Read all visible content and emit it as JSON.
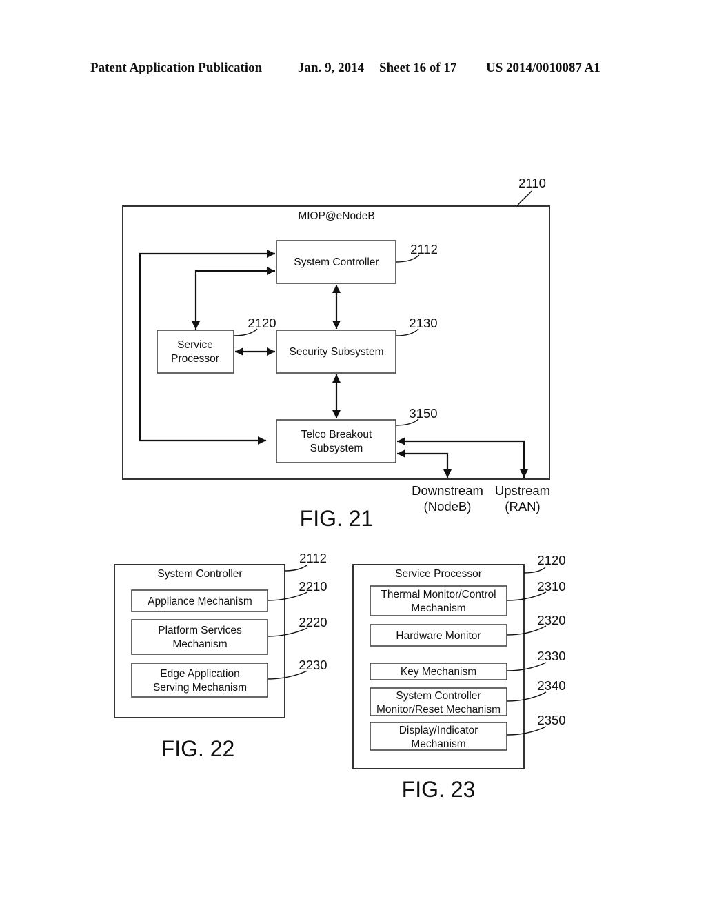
{
  "header": {
    "publication": "Patent Application Publication",
    "date": "Jan. 9, 2014",
    "sheet": "Sheet 16 of 17",
    "number": "US 2014/0010087 A1"
  },
  "fig21": {
    "caption": "FIG. 21",
    "container": {
      "title": "MIOP@eNodeB",
      "ref": "2110"
    },
    "blocks": {
      "system_controller": {
        "lines": [
          "System Controller"
        ],
        "ref": "2112"
      },
      "service_processor": {
        "lines": [
          "Service",
          "Processor"
        ],
        "ref": "2120"
      },
      "security_subsystem": {
        "lines": [
          "Security Subsystem"
        ],
        "ref": "2130"
      },
      "telco_breakout": {
        "lines": [
          "Telco Breakout",
          "Subsystem"
        ],
        "ref": "3150"
      }
    },
    "external": {
      "downstream": [
        "Downstream",
        "(NodeB)"
      ],
      "upstream": [
        "Upstream",
        "(RAN)"
      ]
    },
    "connections": [
      {
        "from": "telco_breakout",
        "to": "system_controller",
        "direction": "to"
      },
      {
        "from": "system_controller",
        "to": "service_processor",
        "direction": "both"
      },
      {
        "from": "system_controller",
        "to": "security_subsystem",
        "direction": "both"
      },
      {
        "from": "service_processor",
        "to": "security_subsystem",
        "direction": "both"
      },
      {
        "from": "security_subsystem",
        "to": "telco_breakout",
        "direction": "both"
      },
      {
        "from": "telco_breakout",
        "to": "downstream",
        "direction": "both"
      },
      {
        "from": "telco_breakout",
        "to": "upstream",
        "direction": "both"
      }
    ]
  },
  "fig22": {
    "caption": "FIG. 22",
    "container": {
      "title": "System Controller",
      "ref": "2112"
    },
    "items": [
      {
        "lines": [
          "Appliance Mechanism"
        ],
        "ref": "2210"
      },
      {
        "lines": [
          "Platform Services",
          "Mechanism"
        ],
        "ref": "2220"
      },
      {
        "lines": [
          "Edge Application",
          "Serving Mechanism"
        ],
        "ref": "2230"
      }
    ]
  },
  "fig23": {
    "caption": "FIG. 23",
    "container": {
      "title": "Service Processor",
      "ref": "2120"
    },
    "items": [
      {
        "lines": [
          "Thermal Monitor/Control",
          "Mechanism"
        ],
        "ref": "2310"
      },
      {
        "lines": [
          "Hardware Monitor"
        ],
        "ref": "2320"
      },
      {
        "lines": [
          "Key Mechanism"
        ],
        "ref": "2330"
      },
      {
        "lines": [
          "System Controller",
          "Monitor/Reset Mechanism"
        ],
        "ref": "2340"
      },
      {
        "lines": [
          "Display/Indicator",
          "Mechanism"
        ],
        "ref": "2350"
      }
    ]
  }
}
